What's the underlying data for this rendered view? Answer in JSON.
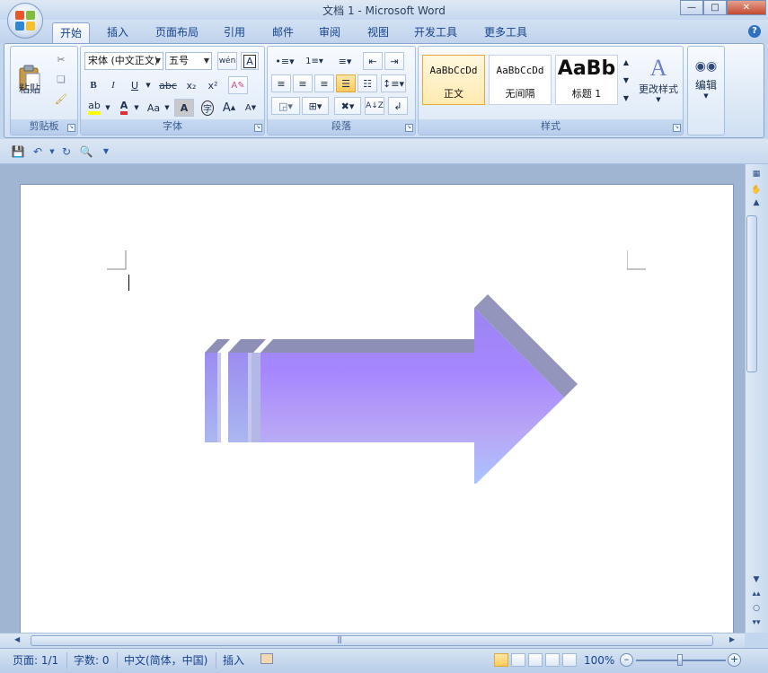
{
  "window": {
    "title": "文档 1 - Microsoft Word"
  },
  "tabs": [
    {
      "label": "开始",
      "active": true
    },
    {
      "label": "插入"
    },
    {
      "label": "页面布局"
    },
    {
      "label": "引用"
    },
    {
      "label": "邮件"
    },
    {
      "label": "审阅"
    },
    {
      "label": "视图"
    },
    {
      "label": "开发工具"
    },
    {
      "label": "更多工具"
    }
  ],
  "ribbon": {
    "clipboard": {
      "label": "剪贴板",
      "paste_label": "粘贴"
    },
    "font": {
      "label": "字体",
      "font_name": "宋体 (中文正文)",
      "font_size": "五号",
      "bold": "B",
      "italic": "I",
      "underline": "U",
      "strike": "abc",
      "subscript": "x₂",
      "superscript": "x²",
      "change_case": "Aa",
      "char_shade": "A",
      "grow": "A",
      "shrink": "A",
      "font_color": "A",
      "enclose": "字"
    },
    "paragraph": {
      "label": "段落"
    },
    "styles": {
      "label": "样式",
      "items": [
        {
          "sample": "AaBbCcDd",
          "name": "正文",
          "selected": true
        },
        {
          "sample": "AaBbCcDd",
          "name": "无间隔"
        },
        {
          "sample": "AaBb",
          "name": "标题 1"
        }
      ],
      "change_styles_label": "更改样式"
    },
    "editing": {
      "label": "编辑"
    }
  },
  "statusbar": {
    "page": "页面: 1/1",
    "words": "字数: 0",
    "language": "中文(简体，中国)",
    "mode": "插入",
    "zoom": "100%"
  },
  "colors": {
    "arrow_top": "#9a86f0",
    "arrow_mid": "#a586ff",
    "arrow_bottom": "#b9a6f5",
    "arrow_light": "#a8c4ff",
    "arrow_side": "#8d8fb6"
  }
}
